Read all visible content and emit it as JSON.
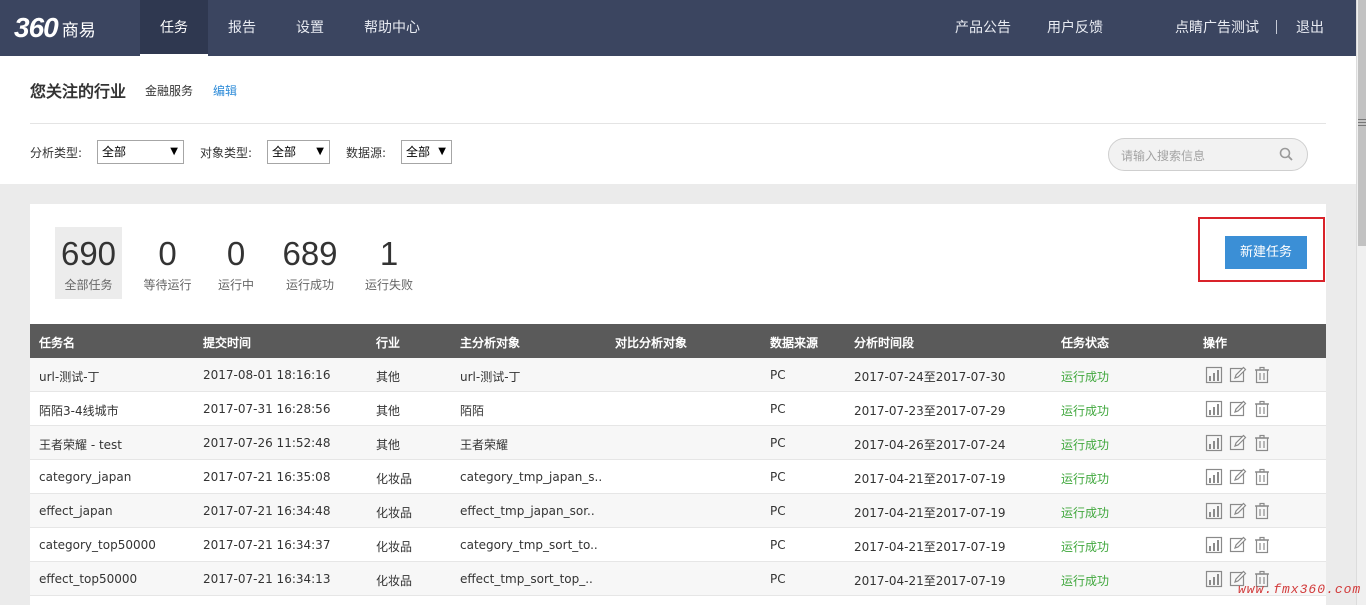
{
  "nav": {
    "logo_number": "360",
    "logo_text": "商易",
    "items": [
      {
        "label": "任务"
      },
      {
        "label": "报告"
      },
      {
        "label": "设置"
      },
      {
        "label": "帮助中心"
      }
    ],
    "right_items": [
      {
        "label": "产品公告"
      },
      {
        "label": "用户反馈"
      },
      {
        "label": "点睛广告测试"
      },
      {
        "label": "退出"
      }
    ],
    "active_index": 0
  },
  "industry": {
    "title": "您关注的行业",
    "value": "金融服务",
    "edit_label": "编辑"
  },
  "filters": [
    {
      "label": "分析类型:",
      "value": "全部"
    },
    {
      "label": "对象类型:",
      "value": "全部"
    },
    {
      "label": "数据源:",
      "value": "全部"
    }
  ],
  "search": {
    "placeholder": "请输入搜索信息"
  },
  "stats": [
    {
      "number": "690",
      "label": "全部任务"
    },
    {
      "number": "0",
      "label": "等待运行"
    },
    {
      "number": "0",
      "label": "运行中"
    },
    {
      "number": "689",
      "label": "运行成功"
    },
    {
      "number": "1",
      "label": "运行失败"
    }
  ],
  "new_task_label": "新建任务",
  "table": {
    "columns": [
      "任务名",
      "提交时间",
      "行业",
      "主分析对象",
      "对比分析对象",
      "数据来源",
      "分析时间段",
      "任务状态",
      "操作"
    ],
    "rows": [
      {
        "name": "url-测试-丁",
        "time": "2017-08-01 18:16:16",
        "industry": "其他",
        "target": "url-测试-丁",
        "compare": "",
        "source": "PC",
        "period": "2017-07-24至2017-07-30",
        "status": "运行成功"
      },
      {
        "name": "陌陌3-4线城市",
        "time": "2017-07-31 16:28:56",
        "industry": "其他",
        "target": "陌陌",
        "compare": "",
        "source": "PC",
        "period": "2017-07-23至2017-07-29",
        "status": "运行成功"
      },
      {
        "name": "王者荣耀 - test",
        "time": "2017-07-26 11:52:48",
        "industry": "其他",
        "target": "王者荣耀",
        "compare": "",
        "source": "PC",
        "period": "2017-04-26至2017-07-24",
        "status": "运行成功"
      },
      {
        "name": "category_japan",
        "time": "2017-07-21 16:35:08",
        "industry": "化妆品",
        "target": "category_tmp_japan_s..",
        "compare": "",
        "source": "PC",
        "period": "2017-04-21至2017-07-19",
        "status": "运行成功"
      },
      {
        "name": "effect_japan",
        "time": "2017-07-21 16:34:48",
        "industry": "化妆品",
        "target": "effect_tmp_japan_sor..",
        "compare": "",
        "source": "PC",
        "period": "2017-04-21至2017-07-19",
        "status": "运行成功"
      },
      {
        "name": "category_top50000",
        "time": "2017-07-21 16:34:37",
        "industry": "化妆品",
        "target": "category_tmp_sort_to..",
        "compare": "",
        "source": "PC",
        "period": "2017-04-21至2017-07-19",
        "status": "运行成功"
      },
      {
        "name": "effect_top50000",
        "time": "2017-07-21 16:34:13",
        "industry": "化妆品",
        "target": "effect_tmp_sort_top_..",
        "compare": "",
        "source": "PC",
        "period": "2017-04-21至2017-07-19",
        "status": "运行成功"
      }
    ]
  },
  "icons": [
    "report-chart-icon",
    "edit-icon",
    "trash-icon",
    "search-icon"
  ],
  "colors": {
    "nav_bg": "#3b4560",
    "accent": "#3b8fd6",
    "success": "#41a83e",
    "header_row": "#5a5a5a",
    "highlight_box": "#d9232a"
  },
  "watermark": "www.fmx360.com"
}
